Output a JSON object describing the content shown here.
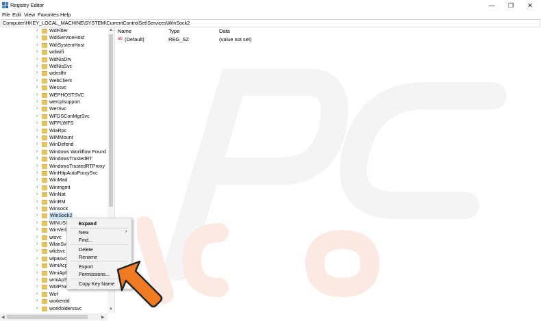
{
  "window": {
    "title": "Registry Editor",
    "minimize_icon": "minimize-icon",
    "restore_icon": "restore-icon",
    "close_icon": "close-icon"
  },
  "menu": [
    "File",
    "Edit",
    "View",
    "Favorites",
    "Help"
  ],
  "address": "Computer\\HKEY_LOCAL_MACHINE\\SYSTEM\\CurrentControlSet\\Services\\WinSock2",
  "tree": [
    "WdFilter",
    "WdiServiceHost",
    "WdiSystemHost",
    "wdiwifi",
    "WdNisDrv",
    "WdNisSvc",
    "wdnsfltr",
    "WebClient",
    "Wecsvc",
    "WEPHOSTSVC",
    "wercplsupport",
    "WerSvc",
    "WFDSConMgrSvc",
    "WFPLWFS",
    "WiaRpc",
    "WIMMount",
    "WinDefend",
    "Windows Workflow Found",
    "WindowsTrustedRT",
    "WindowsTrustedRTProxy",
    "WinHttpAutoProxySvc",
    "WinMad",
    "Winmgmt",
    "WinNat",
    "WinRM",
    "Winsock",
    "WinSock2",
    "WINUSB",
    "WinVerb",
    "wisvc",
    "WlanSvc",
    "wlidsvc",
    "wlpasvc",
    "WmiAcp",
    "WmiApRp",
    "wmiApSrv",
    "WMPNetworkSvc",
    "Wof",
    "workerdd",
    "workfolderssvc"
  ],
  "selected_index": 26,
  "list": {
    "headers": [
      "Name",
      "Type",
      "Data"
    ],
    "rows": [
      {
        "name": "(Default)",
        "type": "REG_SZ",
        "data": "(value not set)"
      }
    ]
  },
  "context_menu": [
    {
      "label": "Expand",
      "bold": true
    },
    {
      "label": "New",
      "submenu": true
    },
    {
      "label": "Find..."
    },
    {
      "label": "Delete"
    },
    {
      "label": "Rename"
    },
    {
      "label": "Export"
    },
    {
      "label": "Permissions..."
    },
    {
      "label": "Copy Key Name"
    }
  ],
  "colors": {
    "selection": "#cce4f7",
    "folder": "#e8c25a",
    "arrow": "#f07a22"
  }
}
